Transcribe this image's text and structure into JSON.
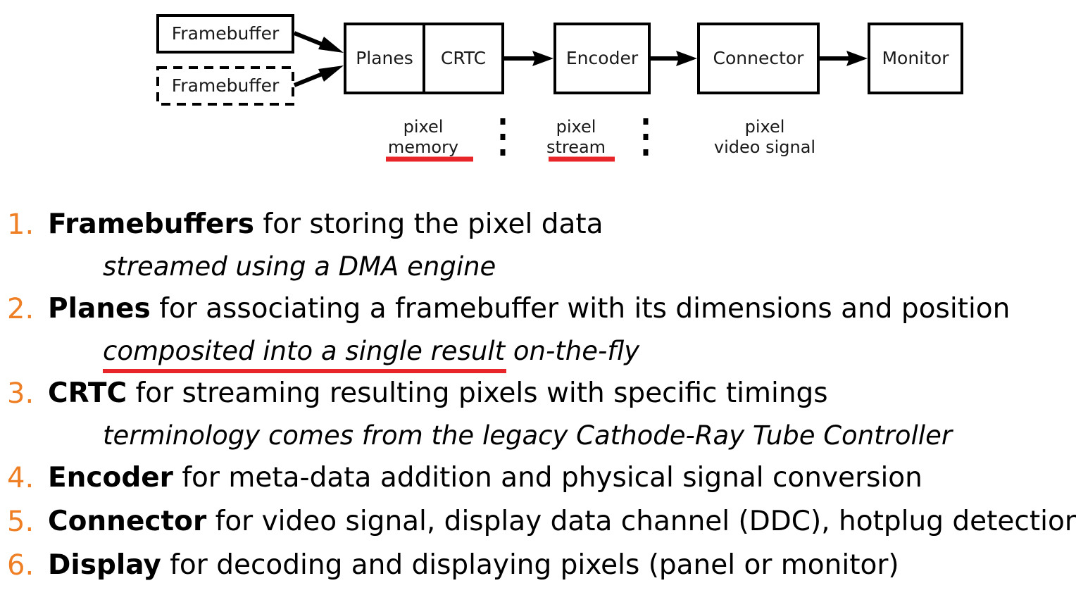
{
  "colors": {
    "number_orange": "#ef7f24",
    "underline_red": "#e8262a",
    "box_stroke": "#000000",
    "text": "#000000",
    "background": "#ffffff"
  },
  "diagram": {
    "nodes": [
      {
        "id": "framebuffer-solid",
        "label": "Framebuffer",
        "style": "solid"
      },
      {
        "id": "framebuffer-dashed",
        "label": "Framebuffer",
        "style": "dashed"
      },
      {
        "id": "planes",
        "label": "Planes",
        "style": "solid"
      },
      {
        "id": "crtc",
        "label": "CRTC",
        "style": "solid"
      },
      {
        "id": "encoder",
        "label": "Encoder",
        "style": "solid"
      },
      {
        "id": "connector",
        "label": "Connector",
        "style": "solid"
      },
      {
        "id": "monitor",
        "label": "Monitor",
        "style": "solid"
      }
    ],
    "captions": [
      {
        "id": "caption-memory",
        "line1": "pixel",
        "line2": "memory",
        "underlined": true
      },
      {
        "id": "caption-stream",
        "line1": "pixel",
        "line2": "stream",
        "underlined": true
      },
      {
        "id": "caption-video-signal",
        "line1": "pixel",
        "line2": "video signal",
        "underlined": false
      }
    ]
  },
  "list": {
    "items": [
      {
        "number": "1.",
        "keyword": "Framebuffers",
        "rest": " for storing the pixel data",
        "sub_before": "",
        "sub_underlined": "",
        "sub_after": "streamed using a DMA engine",
        "has_sub": true
      },
      {
        "number": "2.",
        "keyword": "Planes",
        "rest": " for associating a framebuffer with its dimensions and position",
        "sub_before": "",
        "sub_underlined": "composited into a single result",
        "sub_after": " on-the-fly",
        "has_sub": true
      },
      {
        "number": "3.",
        "keyword": "CRTC",
        "rest": " for streaming resulting pixels with specific timings",
        "sub_before": "",
        "sub_underlined": "",
        "sub_after": "terminology comes from the legacy Cathode-Ray Tube Controller",
        "has_sub": true
      },
      {
        "number": "4.",
        "keyword": "Encoder",
        "rest": " for meta-data addition and physical signal conversion",
        "sub_before": "",
        "sub_underlined": "",
        "sub_after": "",
        "has_sub": false
      },
      {
        "number": "5.",
        "keyword": "Connector",
        "rest": " for video signal, display data channel (DDC), hotplug detection",
        "sub_before": "",
        "sub_underlined": "",
        "sub_after": "",
        "has_sub": false
      },
      {
        "number": "6.",
        "keyword": "Display",
        "rest": " for decoding and displaying pixels (panel or monitor)",
        "sub_before": "",
        "sub_underlined": "",
        "sub_after": "",
        "has_sub": false
      }
    ]
  }
}
